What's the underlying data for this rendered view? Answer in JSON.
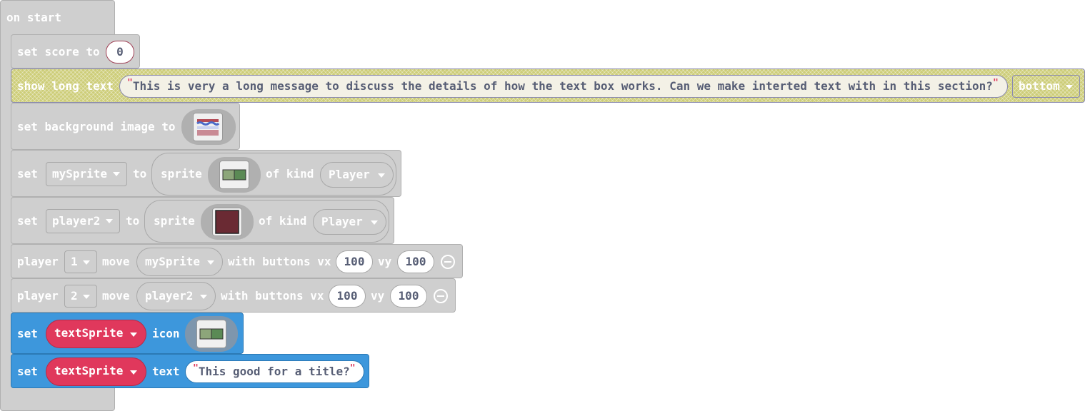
{
  "on_start": {
    "label": "on start"
  },
  "set_score": {
    "label_set": "set score to",
    "value": "0"
  },
  "show_long_text": {
    "label": "show long text",
    "open_quote": "\"",
    "text": "This is very a long message to discuss the details of how the text box works. Can we make interted text with in this section?",
    "close_quote": "\"",
    "position": "bottom"
  },
  "set_background": {
    "label": "set background image to"
  },
  "set_mysprite": {
    "label_set": "set",
    "variable": "mySprite",
    "label_to": "to",
    "label_sprite": "sprite",
    "label_of_kind": "of kind",
    "kind": "Player"
  },
  "set_player2": {
    "label_set": "set",
    "variable": "player2",
    "label_to": "to",
    "label_sprite": "sprite",
    "label_of_kind": "of kind",
    "kind": "Player"
  },
  "player1_move": {
    "label_player": "player",
    "player": "1",
    "label_move": "move",
    "sprite": "mySprite",
    "label_with": "with buttons vx",
    "vx": "100",
    "label_vy": "vy",
    "vy": "100"
  },
  "player2_move": {
    "label_player": "player",
    "player": "2",
    "label_move": "move",
    "sprite": "player2",
    "label_with": "with buttons vx",
    "vx": "100",
    "label_vy": "vy",
    "vy": "100"
  },
  "set_icon": {
    "label_set": "set",
    "variable": "textSprite",
    "label_icon": "icon"
  },
  "set_text": {
    "label_set": "set",
    "variable": "textSprite",
    "label_text": "text",
    "open_quote": "\"",
    "value": "This good for a title?",
    "close_quote": "\""
  },
  "colors": {
    "container_gray": "#cfcfcf",
    "hatch_yellow": "#cdcd78",
    "sprite_blue": "#3d97dc",
    "variable_red": "#e0385c"
  },
  "icons": {
    "background_image": "background-thumbnail-icon",
    "mysprite_image": "green-sprite-icon",
    "player2_image": "maroon-sprite-icon",
    "remove": "minus-circle-icon"
  }
}
